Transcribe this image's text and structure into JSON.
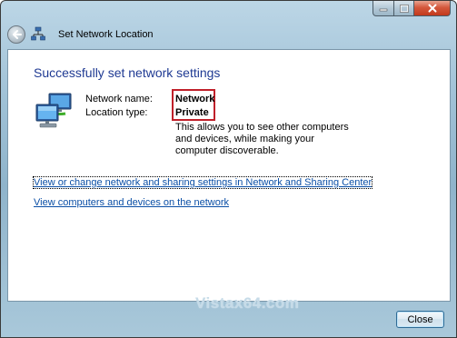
{
  "window": {
    "title": "Set Network Location"
  },
  "main": {
    "heading": "Successfully set network settings",
    "network_name_label": "Network name:",
    "network_name_value": "Network",
    "location_type_label": "Location type:",
    "location_type_value": "Private",
    "description": "This allows you to see other computers and devices, while making your computer discoverable.",
    "links": [
      "View or change network and sharing settings in Network and Sharing Center",
      "View computers and devices on the network"
    ]
  },
  "watermark": "Vistax64.com",
  "footer": {
    "close_label": "Close"
  },
  "icons": {
    "back": "back-arrow-icon",
    "network": "network-icon",
    "computers": "network-computers-icon"
  },
  "colors": {
    "heading": "#1f3a93",
    "link": "#0b4fa6",
    "highlight_border": "#c0202a",
    "close_button_red": "#c2391c"
  }
}
